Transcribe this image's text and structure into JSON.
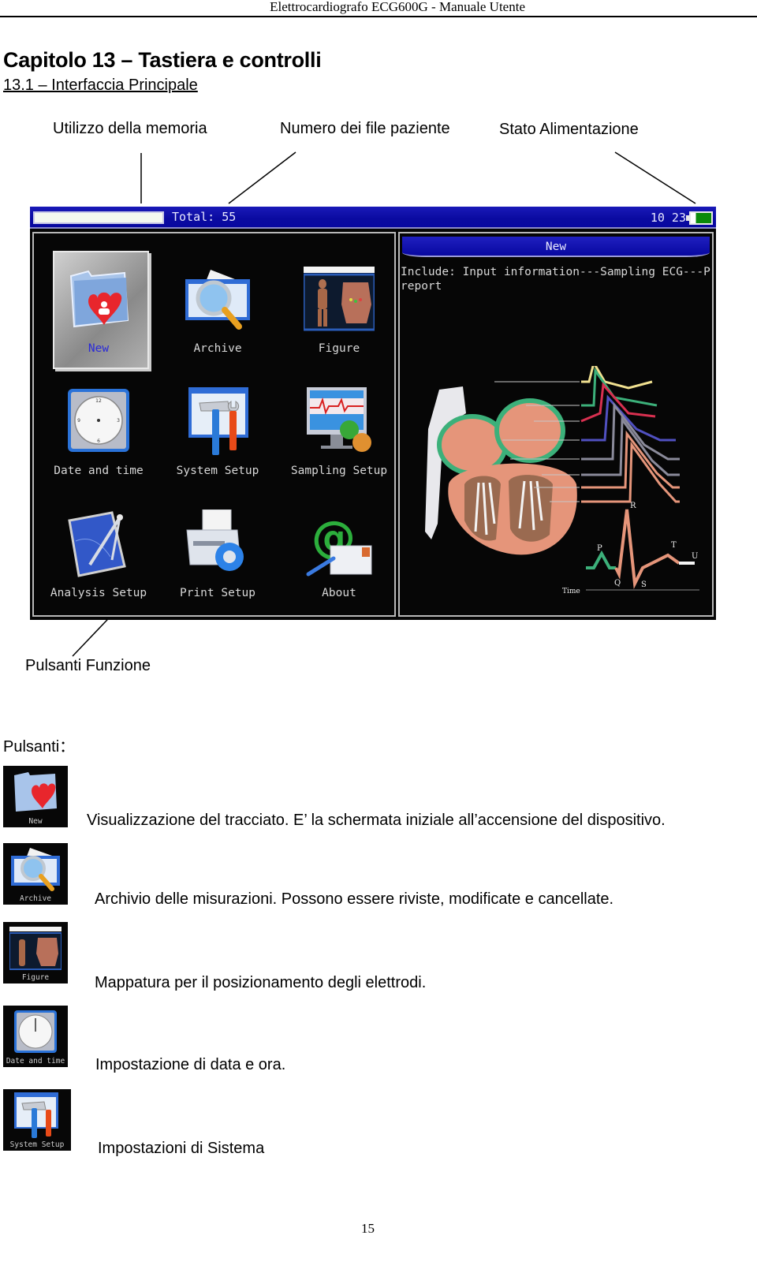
{
  "document": {
    "running_header": "Elettrocardiografo ECG600G - Manuale Utente",
    "chapter_title": "Capitolo 13 – Tastiera e controlli",
    "section_title": "13.1 – Interfaccia Principale",
    "page_number": "15"
  },
  "callouts": {
    "memory_usage": "Utilizzo della memoria",
    "patient_file_count": "Numero dei file paziente",
    "power_status": "Stato Alimentazione",
    "function_buttons": "Pulsanti Funzione"
  },
  "screen": {
    "status_bar": {
      "memory_used_fraction": 0.0,
      "total_label": "Total: 55",
      "time": "10 23",
      "battery_icon": "battery-icon",
      "battery_level_fraction": 0.75
    },
    "menu": [
      {
        "label": "New",
        "icon": "new-patient-folder-heart-icon",
        "selected": true
      },
      {
        "label": "Archive",
        "icon": "archive-magnifier-icon",
        "selected": false
      },
      {
        "label": "Figure",
        "icon": "electrode-figure-icon",
        "selected": false
      },
      {
        "label": "Date and time",
        "icon": "clock-icon",
        "selected": false
      },
      {
        "label": "System Setup",
        "icon": "hammer-wrench-icon",
        "selected": false
      },
      {
        "label": "Sampling Setup",
        "icon": "monitor-gear-icon",
        "selected": false
      },
      {
        "label": "Analysis Setup",
        "icon": "compass-blueprint-icon",
        "selected": false
      },
      {
        "label": "Print Setup",
        "icon": "printer-gear-icon",
        "selected": false
      },
      {
        "label": "About",
        "icon": "at-sign-envelope-icon",
        "selected": false
      }
    ],
    "info_panel": {
      "title": "New",
      "description": "Include: Input information---Sampling ECG---P report",
      "illustration": "heart-conduction-ecg-illustration",
      "wave_labels": {
        "p": "P",
        "q": "Q",
        "r": "R",
        "s": "S",
        "t": "T",
        "u": "U",
        "time": "Time"
      }
    }
  },
  "buttons_section": {
    "heading": "Pulsanti：",
    "items": [
      {
        "icon_label": "New",
        "icon": "new-patient-folder-heart-icon",
        "description": "Visualizzazione del tracciato. E’ la schermata iniziale all’accensione del dispositivo."
      },
      {
        "icon_label": "Archive",
        "icon": "archive-magnifier-icon",
        "description": "Archivio delle misurazioni. Possono essere riviste, modificate e cancellate."
      },
      {
        "icon_label": "Figure",
        "icon": "electrode-figure-icon",
        "description": "Mappatura per il posizionamento degli elettrodi."
      },
      {
        "icon_label": "Date and time",
        "icon": "clock-icon",
        "description": "Impostazione di data e ora."
      },
      {
        "icon_label": "System Setup",
        "icon": "hammer-wrench-icon",
        "description": "Impostazioni di Sistema"
      }
    ]
  },
  "colors": {
    "status_bar_blue": "#0a0aa0",
    "screen_background": "#050505",
    "selected_label_blue": "#2a2ad8",
    "battery_green": "#0a8a0a"
  }
}
